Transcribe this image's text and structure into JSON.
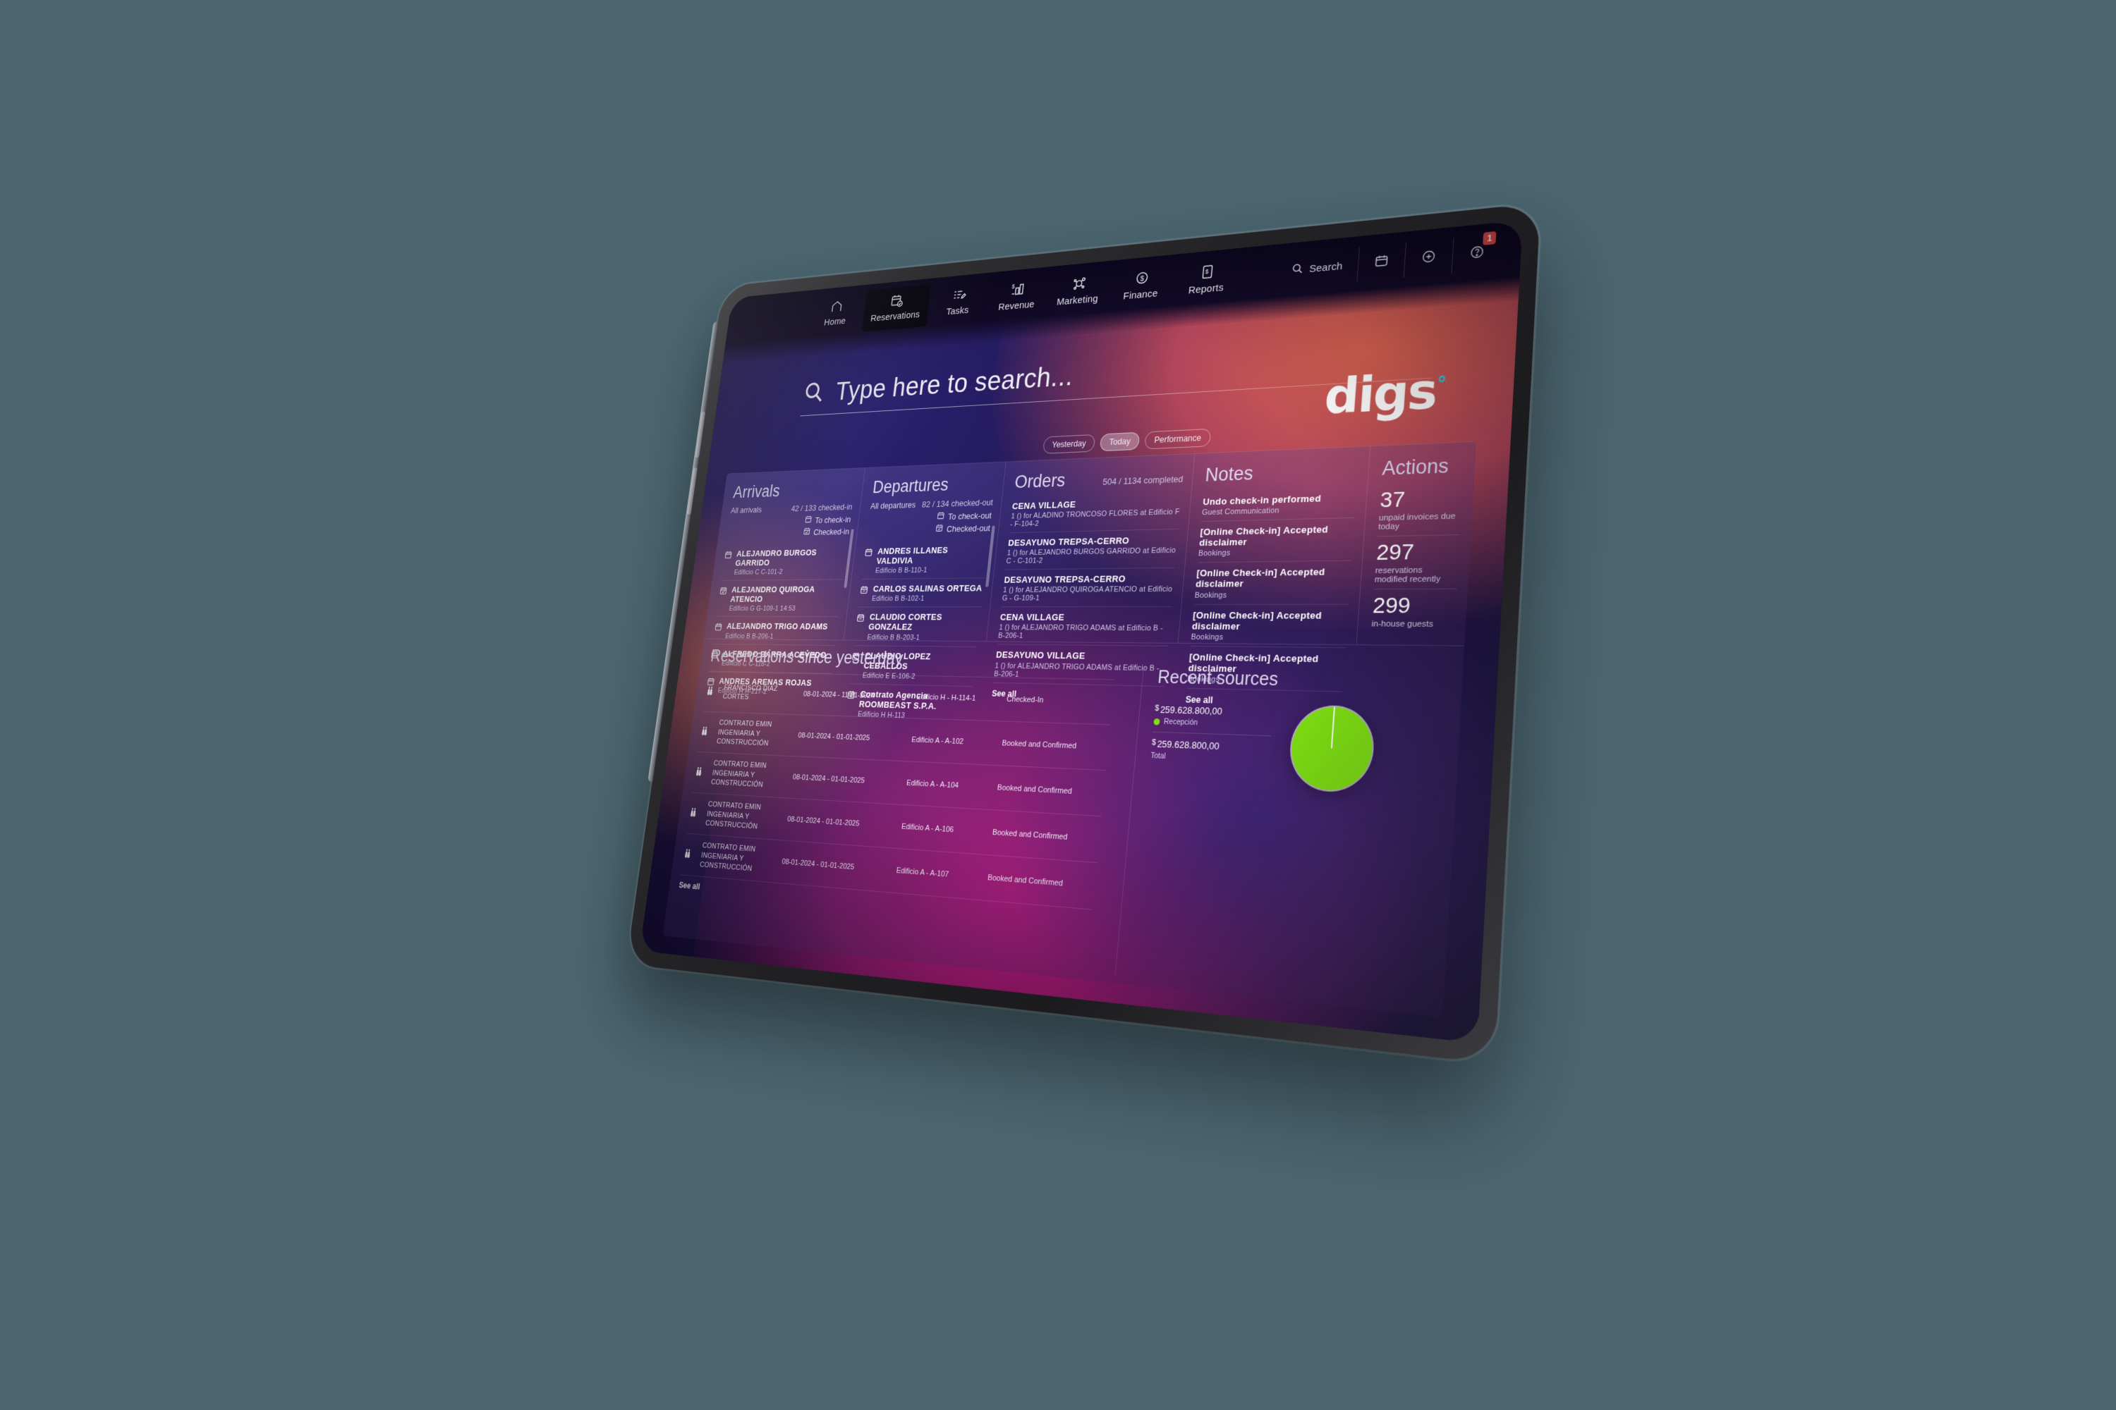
{
  "nav": {
    "items": [
      {
        "label": "Home",
        "icon": "home-icon",
        "active": false
      },
      {
        "label": "Reservations",
        "icon": "calendar-check-icon",
        "active": true
      },
      {
        "label": "Tasks",
        "icon": "task-list-icon",
        "active": false
      },
      {
        "label": "Revenue",
        "icon": "revenue-bars-icon",
        "active": false
      },
      {
        "label": "Marketing",
        "icon": "marketing-node-icon",
        "active": false
      },
      {
        "label": "Finance",
        "icon": "dollar-circle-icon",
        "active": false
      },
      {
        "label": "Reports",
        "icon": "report-doc-icon",
        "active": false
      }
    ]
  },
  "toolbar": {
    "search_label": "Search",
    "calendar_icon": "calendar-icon",
    "add_icon": "plus-circle-icon",
    "help_icon": "help-circle-icon",
    "badge_count": "1"
  },
  "search": {
    "placeholder": "Type here to search...",
    "icon": "search-icon"
  },
  "brand": {
    "name": "digs",
    "degree": "°",
    "accent": "#22d3ee"
  },
  "filters": {
    "options": [
      "Yesterday",
      "Today",
      "Performance"
    ],
    "selected": "Today"
  },
  "arrivals": {
    "title": "Arrivals",
    "all_label": "All arrivals",
    "count": "42 / 133 checked-in",
    "legend": [
      "To check-in",
      "Checked-in"
    ],
    "items": [
      {
        "name": "ALEJANDRO BURGOS GARRIDO",
        "room": "Edificio C C-101-2",
        "state": "to-check-in"
      },
      {
        "name": "ALEJANDRO QUIROGA ATENCIO",
        "room": "Edificio G G-109-1 14:53",
        "state": "checked-in"
      },
      {
        "name": "ALEJANDRO TRIGO ADAMS",
        "room": "Edificio B B-206-1",
        "state": "to-check-in"
      },
      {
        "name": "ALFREDO BARRA ACEVEDO",
        "room": "Edificio C C-118-2",
        "state": "to-check-in"
      },
      {
        "name": "ANDRES ARENAS ROJAS",
        "room": "Edificio H H-217-2",
        "state": "to-check-in"
      }
    ]
  },
  "departures": {
    "title": "Departures",
    "all_label": "All departures",
    "count": "82 / 134 checked-out",
    "legend": [
      "To check-out",
      "Checked-out"
    ],
    "items": [
      {
        "name": "ANDRES ILLANES VALDIVIA",
        "room": "Edificio B B-110-1"
      },
      {
        "name": "CARLOS SALINAS ORTEGA",
        "room": "Edificio B B-102-1"
      },
      {
        "name": "CLAUDIO CORTES GONZALEZ",
        "room": "Edificio B B-203-1"
      },
      {
        "name": "CLAUDIO LOPEZ CEBALLOS",
        "room": "Edificio E E-106-2"
      },
      {
        "name": "Contrato Agencia ROOMBEAST S.P.A.",
        "room": "Edificio H H-113"
      }
    ]
  },
  "orders": {
    "title": "Orders",
    "count": "504 / 1134 completed",
    "see_all": "See all",
    "items": [
      {
        "name": "CENA VILLAGE",
        "detail": "1 () for ALADINO TRONCOSO FLORES at Edificio F - F-104-2"
      },
      {
        "name": "DESAYUNO TREPSA-CERRO",
        "detail": "1 () for ALEJANDRO BURGOS GARRIDO at Edificio C - C-101-2"
      },
      {
        "name": "DESAYUNO TREPSA-CERRO",
        "detail": "1 () for ALEJANDRO QUIROGA ATENCIO at Edificio G - G-109-1"
      },
      {
        "name": "CENA VILLAGE",
        "detail": "1 () for ALEJANDRO TRIGO ADAMS at Edificio B - B-206-1"
      },
      {
        "name": "DESAYUNO VILLAGE",
        "detail": "1 () for ALEJANDRO TRIGO ADAMS at Edificio B - B-206-1"
      }
    ]
  },
  "notes": {
    "title": "Notes",
    "see_all": "See all",
    "items": [
      {
        "name": "Undo check-in performed",
        "detail": "Guest Communication"
      },
      {
        "name": "[Online Check-in] Accepted disclaimer",
        "detail": "Bookings"
      },
      {
        "name": "[Online Check-in] Accepted disclaimer",
        "detail": "Bookings"
      },
      {
        "name": "[Online Check-in] Accepted disclaimer",
        "detail": "Bookings"
      },
      {
        "name": "[Online Check-in] Accepted disclaimer",
        "detail": "Bookings"
      }
    ]
  },
  "actions": {
    "title": "Actions",
    "items": [
      {
        "number": "37",
        "label": "unpaid invoices due today"
      },
      {
        "number": "297",
        "label": "reservations modified recently"
      },
      {
        "number": "299",
        "label": "in-house guests"
      }
    ]
  },
  "reservations_since": {
    "title": "Reservations since yesterday",
    "see_all": "See all",
    "rows": [
      {
        "icon": "binoculars-icon",
        "guest": "FRANCISCO DIAZ CORTES",
        "dates": "08-01-2024 - 11-01-2024",
        "room": "Edificio H - H-114-1",
        "status": "Checked-In"
      },
      {
        "icon": "binoculars-icon",
        "guest": "CONTRATO EMIN INGENIARIA Y CONSTRUCCIÓN",
        "dates": "08-01-2024 - 01-01-2025",
        "room": "Edificio A - A-102",
        "status": "Booked and Confirmed"
      },
      {
        "icon": "binoculars-icon",
        "guest": "CONTRATO EMIN INGENIARIA Y CONSTRUCCIÓN",
        "dates": "08-01-2024 - 01-01-2025",
        "room": "Edificio A - A-104",
        "status": "Booked and Confirmed"
      },
      {
        "icon": "binoculars-icon",
        "guest": "CONTRATO EMIN INGENIARIA Y CONSTRUCCIÓN",
        "dates": "08-01-2024 - 01-01-2025",
        "room": "Edificio A - A-106",
        "status": "Booked and Confirmed"
      },
      {
        "icon": "binoculars-icon",
        "guest": "CONTRATO EMIN INGENIARIA Y CONSTRUCCIÓN",
        "dates": "08-01-2024 - 01-01-2025",
        "room": "Edificio A - A-107",
        "status": "Booked and Confirmed"
      }
    ]
  },
  "recent_sources": {
    "title": "Recent sources",
    "chart_color": "#7ee012",
    "items": [
      {
        "amount": "259.628.800,00",
        "currency": "$",
        "tag": "Recepción",
        "has_dot": true
      },
      {
        "amount": "259.628.800,00",
        "currency": "$",
        "tag": "Total",
        "has_dot": false
      }
    ]
  }
}
